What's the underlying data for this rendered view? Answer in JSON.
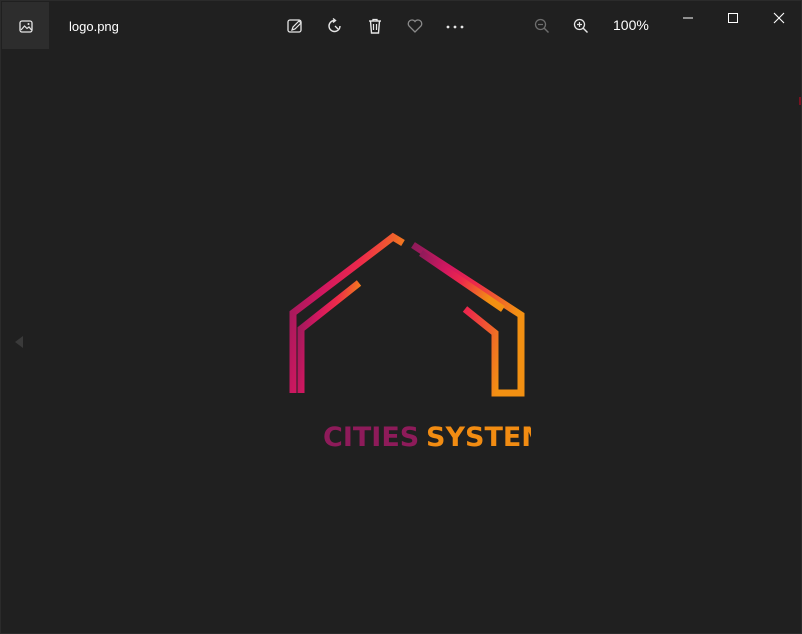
{
  "titlebar": {
    "app_icon": "photos-app-icon",
    "file_name": "logo.png",
    "zoom_level": "100%"
  },
  "toolbar": {
    "icons": [
      "edit-image-icon",
      "rotate-icon",
      "delete-icon",
      "favorite-heart-icon",
      "more-options-icon",
      "zoom-out-icon",
      "zoom-in-icon"
    ]
  },
  "window_controls": {
    "icons": [
      "minimize-icon",
      "maximize-icon",
      "close-icon"
    ]
  },
  "navigation": {
    "prev_icon": "previous-arrow-icon"
  },
  "image": {
    "logo_text_1": "CITIES",
    "logo_text_2": "SYSTEM",
    "colors": {
      "purple": "#8e1b5a",
      "magenta": "#e0155c",
      "red": "#ee2a4a",
      "orange": "#f28c12",
      "background": "#202020"
    }
  }
}
